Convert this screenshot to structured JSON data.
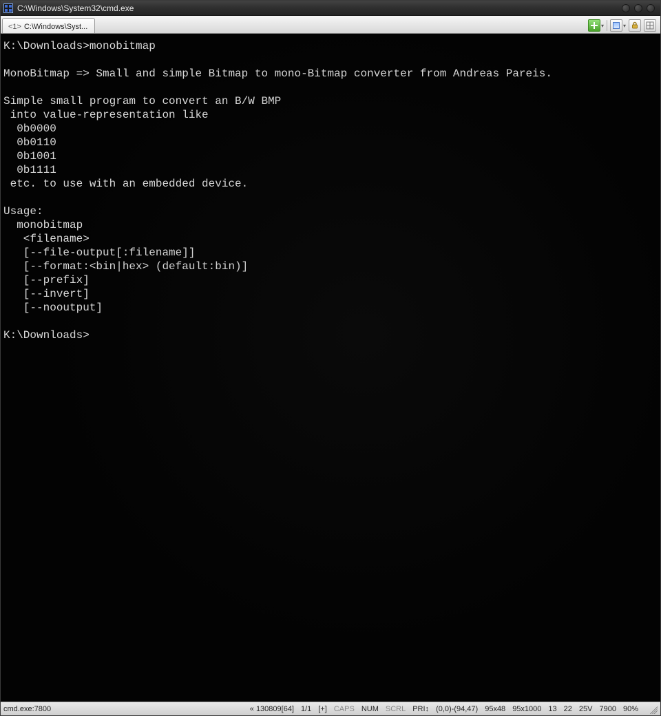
{
  "window": {
    "title": "C:\\Windows\\System32\\cmd.exe"
  },
  "tabs": {
    "active_prefix": "<1>",
    "active_label": "C:\\Windows\\Syst..."
  },
  "terminal": {
    "lines": [
      "K:\\Downloads>monobitmap",
      "",
      "MonoBitmap => Small and simple Bitmap to mono-Bitmap converter from Andreas Pareis.",
      "",
      "Simple small program to convert an B/W BMP",
      " into value-representation like",
      "  0b0000",
      "  0b0110",
      "  0b1001",
      "  0b1111",
      " etc. to use with an embedded device.",
      "",
      "Usage:",
      "  monobitmap",
      "   <filename>",
      "   [--file-output[:filename]]",
      "   [--format:<bin|hex> (default:bin)]",
      "   [--prefix]",
      "   [--invert]",
      "   [--nooutput]",
      "",
      "K:\\Downloads>"
    ]
  },
  "statusbar": {
    "process": "cmd.exe:7800",
    "bytes": "« 130809[64]",
    "pages": "1/1",
    "scroll_mode": "[+]",
    "caps": "CAPS",
    "num": "NUM",
    "scrl": "SCRL",
    "pri": "PRI↕",
    "sel": "(0,0)-(94,47)",
    "size1": "95x48",
    "size2": "95x1000",
    "v1": "13",
    "v2": "22",
    "v3": "25V",
    "v4": "7900",
    "pct": "90%"
  },
  "icons": {
    "app": "cmd-app-icon",
    "add": "add-tab-icon",
    "dropdown": "dropdown-icon",
    "view": "view-layout-icon",
    "lock": "lock-icon",
    "grid": "grid-icon"
  }
}
